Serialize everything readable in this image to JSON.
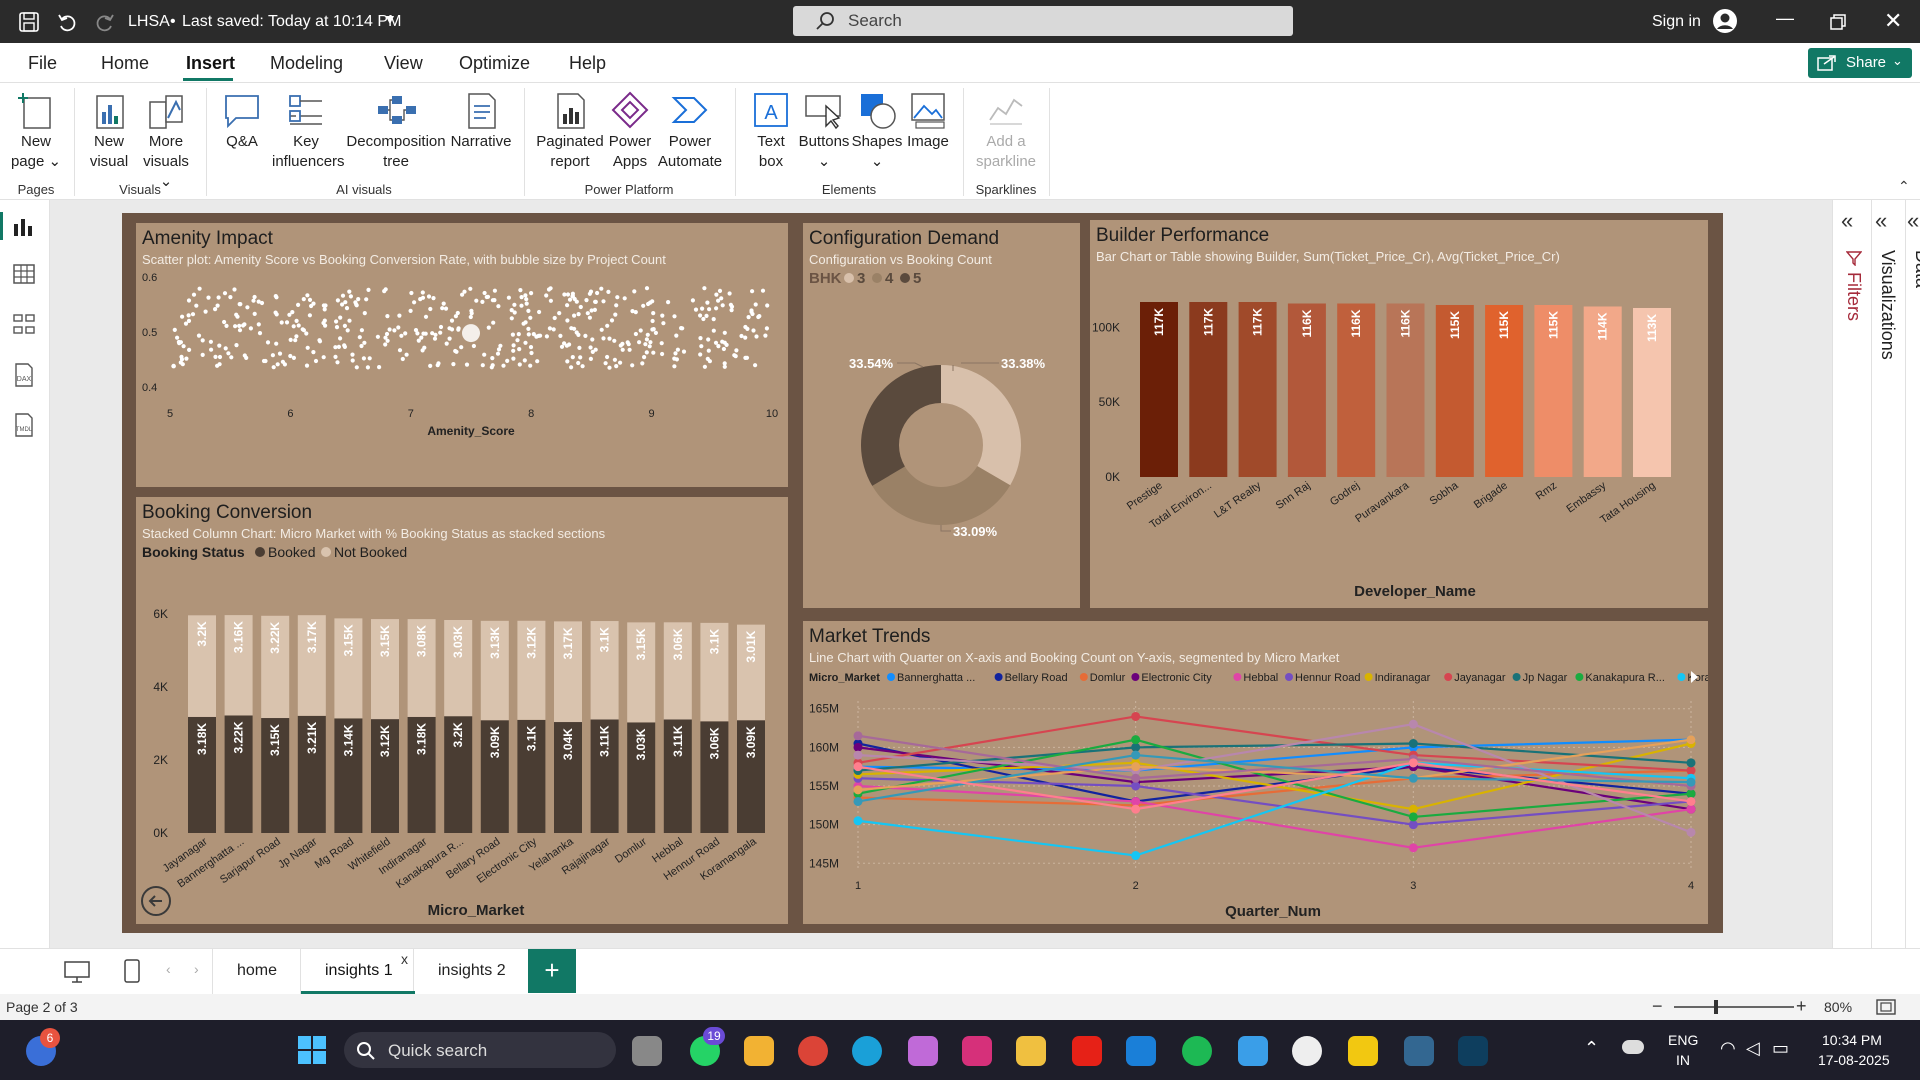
{
  "app": {
    "title": "LHSA",
    "save_status": "Last saved: Today at 10:14 PM",
    "search_placeholder": "Search",
    "sign_in": "Sign in",
    "share": "Share"
  },
  "menu": [
    "File",
    "Home",
    "Insert",
    "Modeling",
    "View",
    "Optimize",
    "Help"
  ],
  "menu_active": "Insert",
  "ribbon": {
    "buttons": {
      "new_page": "New",
      "new_page2": "page",
      "new_visual": "New",
      "new_visual2": "visual",
      "more_visuals": "More",
      "more_visuals2": "visuals",
      "qa": "Q&A",
      "key": "Key",
      "key2": "influencers",
      "decomp": "Decomposition",
      "decomp2": "tree",
      "narrative": "Narrative",
      "paginated": "Paginated",
      "paginated2": "report",
      "power_apps": "Power",
      "power_apps2": "Apps",
      "power_automate": "Power",
      "power_automate2": "Automate",
      "text_box": "Text",
      "text_box2": "box",
      "buttons": "Buttons",
      "shapes": "Shapes",
      "image": "Image",
      "sparkline": "Add a",
      "sparkline2": "sparkline"
    },
    "groups": {
      "pages": "Pages",
      "visuals": "Visuals",
      "ai": "AI visuals",
      "platform": "Power Platform",
      "elements": "Elements",
      "sparklines": "Sparklines"
    }
  },
  "panes": {
    "filters": "Filters",
    "visualizations": "Visualizations",
    "data": "Data"
  },
  "tiles": {
    "amenity": {
      "title": "Amenity Impact",
      "subtitle": "Scatter plot: Amenity Score vs Booking Conversion Rate, with bubble size by Project Count",
      "xlabel": "Amenity_Score"
    },
    "config": {
      "title": "Configuration Demand",
      "subtitle": "Configuration vs Booking Count",
      "legend_title": "BHK"
    },
    "builder": {
      "title": "Builder Performance",
      "subtitle": "Bar Chart or Table showing Builder, Sum(Ticket_Price_Cr), Avg(Ticket_Price_Cr)",
      "xlabel": "Developer_Name"
    },
    "booking": {
      "title": "Booking Conversion",
      "subtitle": "Stacked Column Chart: Micro Market with % Booking Status as stacked sections",
      "legend_title": "Booking Status",
      "xlabel": "Micro_Market"
    },
    "trends": {
      "title": "Market Trends",
      "subtitle": "Line Chart with Quarter on X-axis and Booking Count on Y-axis, segmented by Micro Market",
      "legend_title": "Micro_Market",
      "xlabel": "Quarter_Num"
    }
  },
  "chart_data": [
    {
      "type": "scatter",
      "title": "Amenity Impact",
      "xlabel": "Amenity_Score",
      "xlim": [
        5,
        10
      ],
      "ylim": [
        0.4,
        0.6
      ],
      "xticks": [
        "5",
        "6",
        "7",
        "8",
        "9",
        "10"
      ],
      "yticks": [
        "0.6",
        "0.5",
        "0.4"
      ],
      "point_color": "#ffffff",
      "note": "dense cloud of ~450 points between y 0.43 and 0.58"
    },
    {
      "type": "pie",
      "title": "Configuration Demand",
      "legend_title": "BHK",
      "labels": [
        "3",
        "4",
        "5"
      ],
      "values": [
        33.38,
        33.09,
        33.54
      ],
      "value_labels": [
        "33.38%",
        "33.09%",
        "33.54%"
      ],
      "colors": [
        "#d8c0ab",
        "#9a8166",
        "#5a4a3d"
      ]
    },
    {
      "type": "bar",
      "title": "Builder Performance",
      "xlabel": "Developer_Name",
      "categories": [
        "Prestige",
        "Total Environ...",
        "L&T Realty",
        "Snn Raj",
        "Godrej",
        "Puravankara",
        "Sobha",
        "Brigade",
        "Rmz",
        "Embassy",
        "Tata Housing"
      ],
      "values": [
        117,
        117,
        117,
        116,
        116,
        116,
        115,
        115,
        115,
        114,
        113
      ],
      "value_labels": [
        "117K",
        "117K",
        "117K",
        "116K",
        "116K",
        "116K",
        "115K",
        "115K",
        "115K",
        "114K",
        "113K"
      ],
      "unit": "K",
      "yticks": [
        "100K",
        "50K",
        "0K"
      ],
      "colors": [
        "#6b1f07",
        "#8b3a1e",
        "#a04a2a",
        "#b2583a",
        "#c0603c",
        "#b87558",
        "#c45a30",
        "#e0622d",
        "#ee8d68",
        "#f2a889",
        "#f5c5ae"
      ]
    },
    {
      "type": "bar",
      "title": "Booking Conversion",
      "stacked": true,
      "xlabel": "Micro_Market",
      "categories": [
        "Jayanagar",
        "Bannerghatta ...",
        "Sarjapur Road",
        "Jp Nagar",
        "Mg Road",
        "Whitefield",
        "Indiranagar",
        "Kanakapura R...",
        "Bellary Road",
        "Electronic City",
        "Yelahanka",
        "Rajajinagar",
        "Domlur",
        "Hebbal",
        "Hennur Road",
        "Koramangala"
      ],
      "series": [
        {
          "name": "Booked",
          "values": [
            3.18,
            3.22,
            3.15,
            3.21,
            3.14,
            3.12,
            3.18,
            3.2,
            3.09,
            3.1,
            3.04,
            3.11,
            3.03,
            3.11,
            3.06,
            3.09
          ],
          "labels": [
            "3.18K",
            "3.22K",
            "3.15K",
            "3.21K",
            "3.14K",
            "3.12K",
            "3.18K",
            "3.2K",
            "3.09K",
            "3.1K",
            "3.04K",
            "3.11K",
            "3.03K",
            "3.11K",
            "3.06K",
            "3.09K"
          ],
          "color": "#4a3d33"
        },
        {
          "name": "Not Booked",
          "values": [
            3.2,
            3.16,
            3.22,
            3.17,
            3.15,
            3.15,
            3.08,
            3.03,
            3.13,
            3.12,
            3.17,
            3.1,
            3.15,
            3.06,
            3.1,
            3.01
          ],
          "labels": [
            "3.2K",
            "3.16K",
            "3.22K",
            "3.17K",
            "3.15K",
            "3.15K",
            "3.08K",
            "3.03K",
            "3.13K",
            "3.12K",
            "3.17K",
            "3.1K",
            "3.15K",
            "3.06K",
            "3.1K",
            "3.01K"
          ],
          "color": "#d9c3ae"
        }
      ],
      "yticks": [
        "6K",
        "4K",
        "2K",
        "0K"
      ],
      "ylim": [
        0,
        6.6
      ]
    },
    {
      "type": "line",
      "title": "Market Trends",
      "xlabel": "Quarter_Num",
      "x": [
        1,
        2,
        3,
        4
      ],
      "yticks": [
        "165M",
        "160M",
        "155M",
        "150M",
        "145M"
      ],
      "ylim": [
        144,
        166
      ],
      "legend_title": "Micro_Market",
      "series": [
        {
          "name": "Bannerghatta ...",
          "color": "#118dff",
          "values": [
            157.5,
            157,
            160,
            161
          ]
        },
        {
          "name": "Bellary Road",
          "color": "#12239e",
          "values": [
            160.5,
            153,
            157.5,
            154
          ]
        },
        {
          "name": "Domlur",
          "color": "#e66c37",
          "values": [
            153.5,
            152.5,
            156,
            157
          ]
        },
        {
          "name": "Electronic City",
          "color": "#6b007b",
          "values": [
            160,
            155.5,
            157.5,
            152
          ]
        },
        {
          "name": "Hebbal",
          "color": "#e044a7",
          "values": [
            155,
            153,
            147,
            152
          ]
        },
        {
          "name": "Hennur Road",
          "color": "#744ec2",
          "values": [
            156,
            155,
            150,
            153
          ]
        },
        {
          "name": "Indiranagar",
          "color": "#d9b300",
          "values": [
            156.5,
            158,
            152,
            160.5
          ]
        },
        {
          "name": "Jayanagar",
          "color": "#d64550",
          "values": [
            158,
            164,
            159,
            157
          ]
        },
        {
          "name": "Jp Nagar",
          "color": "#197278",
          "values": [
            157,
            160,
            160.5,
            158
          ]
        },
        {
          "name": "Kanakapura R...",
          "color": "#1aab40",
          "values": [
            154,
            161,
            151,
            154
          ]
        },
        {
          "name": "Koramangala",
          "color": "#15c6f4",
          "values": [
            150.5,
            146,
            158,
            156
          ]
        },
        {
          "name": "",
          "color": "#b887ad",
          "values": [
            159,
            157,
            163,
            149
          ]
        },
        {
          "name": "",
          "color": "#e6a15a",
          "values": [
            154.5,
            157.5,
            156,
            161
          ]
        },
        {
          "name": "",
          "color": "#a66999",
          "values": [
            161.5,
            156,
            158.5,
            155
          ]
        },
        {
          "name": "",
          "color": "#3599b8",
          "values": [
            153,
            159,
            156,
            155.5
          ]
        },
        {
          "name": "",
          "color": "#ff7f8e",
          "values": [
            157.5,
            152,
            158,
            153
          ]
        }
      ]
    }
  ],
  "page_tabs": [
    "home",
    "insights 1",
    "insights 2"
  ],
  "active_tab": "insights 1",
  "status": {
    "page": "Page 2 of 3",
    "zoom": "80%"
  },
  "taskbar": {
    "search": "Quick search",
    "notif_count": "6",
    "whatsapp_count": "19",
    "lang1": "ENG",
    "lang2": "IN",
    "time": "10:34 PM",
    "date": "17-08-2025"
  }
}
